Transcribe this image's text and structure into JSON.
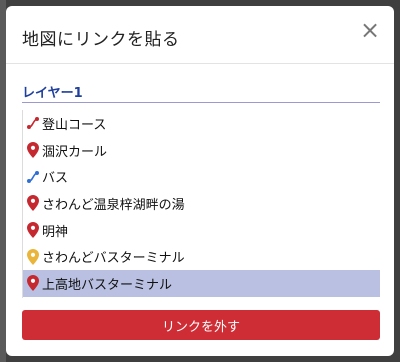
{
  "modal": {
    "title": "地図にリンクを貼る",
    "close_symbol": "×"
  },
  "layer": {
    "name": "レイヤー1"
  },
  "items": [
    {
      "label": "登山コース",
      "icon": "route-icon",
      "color": "#c6282f"
    },
    {
      "label": "涸沢カール",
      "icon": "map-pin-icon",
      "color": "#c6282f"
    },
    {
      "label": "バス",
      "icon": "route-icon",
      "color": "#2f6fd6"
    },
    {
      "label": "さわんど温泉梓湖畔の湯",
      "icon": "map-pin-icon",
      "color": "#c6282f"
    },
    {
      "label": "明神",
      "icon": "map-pin-icon",
      "color": "#c6282f"
    },
    {
      "label": "さわんどバスターミナル",
      "icon": "map-pin-icon",
      "color": "#e9b53a"
    },
    {
      "label": "上高地バスターミナル",
      "icon": "map-pin-icon",
      "color": "#c6282f",
      "selected": true
    }
  ],
  "actions": {
    "unlink_label": "リンクを外す"
  },
  "colors": {
    "accent": "#cf2d35",
    "layer_title": "#1f3f9c",
    "selected_row": "#b9c0e1"
  }
}
